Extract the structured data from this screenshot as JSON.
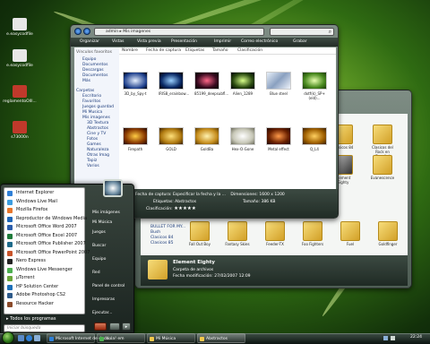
{
  "desktop": {
    "icons": [
      {
        "label": "e.easycodfile",
        "color": "#e7e7e7"
      },
      {
        "label": "e.easycodfile",
        "color": "#e7e7e7"
      },
      {
        "label": "reglamentoOlll...",
        "color": "#c0392b"
      },
      {
        "label": "s73000n",
        "color": "#c0392b"
      }
    ]
  },
  "explorer": {
    "breadcrumb": [
      "admin",
      "Mis imagenes"
    ],
    "toolbar": [
      "Organizar",
      "Vistas",
      "Vista previa",
      "Presentación",
      "Imprimir",
      "Correo electrónico",
      "Grabar"
    ],
    "columns": [
      "Nombre",
      "Fecha de captura",
      "Etiquetas",
      "Tamaño",
      "Clasificación"
    ],
    "sidebar": {
      "links_title": "Vínculos favoritos",
      "links": [
        "Equipo",
        "Documentos",
        "Descargas",
        "Documentos",
        "Más"
      ],
      "folders_title": "Carpetas",
      "folders": [
        "Escritorio",
        "Favoritos",
        "Juegos guardad",
        "Mi Musica",
        "Mis imagenes",
        "3D Textura",
        "Abstractos",
        "Cine y TV",
        "Fotos",
        "Games",
        "Naturaleza",
        "Otras Imag",
        "Tapiz",
        "Varios"
      ]
    },
    "thumbnails": [
      "3D_by_Spy-t",
      "IRIS8_erainbow...",
      "85199_deepsubfl...",
      "Alien_1289",
      "Blue steel",
      "dxtf(k)_SP+ (eld)...",
      "Firepath",
      "GOLD",
      "GoldBa",
      "Hex-O-Gone",
      "Metal effect",
      "Q_L4"
    ],
    "details": {
      "capture": "Fecha de captura: Especificar la fecha y la ...",
      "dimensions": "Dimensiones: 1600 x 1200",
      "tags": "Etiquetas: Abstractos",
      "size": "Tamaño: 386 KB",
      "rating_label": "Clasificación:",
      "stars": "★★★★★"
    }
  },
  "music": {
    "folders_top": [
      "Clasicos 84",
      "Clasicos del Rock en Español"
    ],
    "folders_mid": [
      "Element Eighty",
      "Evanescence"
    ],
    "sidebar": [
      "BULLET FOR MY...",
      "Bush",
      "Clasicos 84",
      "Clasicos 85"
    ],
    "folders_bottom": [
      "Fall Out Boy",
      "Fantasy Skies",
      "Feeder-TX",
      "Foo Fighters",
      "Fuel",
      "Goldfinger"
    ],
    "details": {
      "name": "Element Eighty",
      "type": "Carpeta de archivos",
      "modified": "Fecha modificación: 27/02/2007 12:09"
    }
  },
  "start_menu": {
    "programs": [
      {
        "label": "Internet Explorer",
        "color": "#2f7fd6"
      },
      {
        "label": "Windows Live Mail",
        "color": "#3c9de0"
      },
      {
        "label": "Mozilla Firefox",
        "color": "#e8762b"
      },
      {
        "label": "Reproductor de Windows Media",
        "color": "#1e66b8"
      },
      {
        "label": "Microsoft Office Word 2007",
        "color": "#2a5caa"
      },
      {
        "label": "Microsoft Office Excel 2007",
        "color": "#1e7a3a"
      },
      {
        "label": "Microsoft Office Publisher 2007",
        "color": "#1e6a8a"
      },
      {
        "label": "Microsoft Office PowerPoint 2007",
        "color": "#c8542a"
      },
      {
        "label": "Nero Express",
        "color": "#222222"
      },
      {
        "label": "Windows Live Messenger",
        "color": "#4caf50"
      },
      {
        "label": "µTorrent",
        "color": "#6aa63a"
      },
      {
        "label": "HP Solution Center",
        "color": "#1c6fb8"
      },
      {
        "label": "Adobe Photoshop CS2",
        "color": "#2d5a8a"
      },
      {
        "label": "Resource Hacker",
        "color": "#8a4a2a"
      }
    ],
    "all_programs": "Todos los programas",
    "search_placeholder": "Iniciar búsqueda",
    "right": [
      "Mis imágenes",
      "Mi Música",
      "Juegos",
      "Buscar",
      "Equipo",
      "Red",
      "Panel de control",
      "Impresoras",
      "Ejecutar..."
    ]
  },
  "taskbar": {
    "tasks": [
      "Microsoft Internet de deco...",
      "Hola! em",
      "Mi Música",
      "Abstractos"
    ],
    "clock": "22:24"
  }
}
